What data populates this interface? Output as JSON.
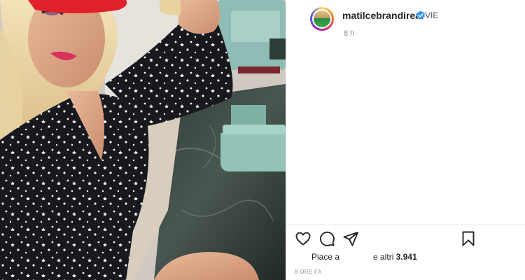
{
  "post": {
    "username": "matilcebrandireal",
    "subtitle": "VIE",
    "time_short": "8 h",
    "likes_prefix": "Piace a",
    "likes_suffix": "e altri",
    "likes_count": "3.941",
    "time_long": "8 ORE FA"
  },
  "icons": {
    "like": "heart-icon",
    "comment": "comment-bubble-icon",
    "share": "paper-plane-icon",
    "save": "bookmark-icon",
    "verified": "verified-badge-icon"
  },
  "colors": {
    "verified_blue": "#3897f0",
    "text": "#262626",
    "muted": "#8e8e8e",
    "hat_red": "#e0202a"
  }
}
